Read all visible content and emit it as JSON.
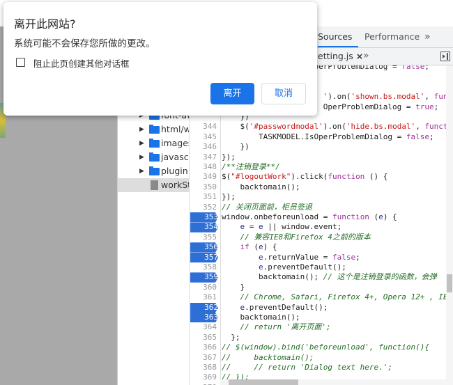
{
  "devtools": {
    "tabs": [
      {
        "label": "Sources",
        "active": true
      },
      {
        "label": "Performance",
        "active": false
      }
    ],
    "more_tabs": "»",
    "open_file": {
      "name": "etting.js",
      "close": "×"
    },
    "more_files": "»",
    "file_tree": [
      {
        "label": "font-aw",
        "type": "folder"
      },
      {
        "label": "html/w",
        "type": "folder"
      },
      {
        "label": "images",
        "type": "folder"
      },
      {
        "label": "javascri",
        "type": "folder"
      },
      {
        "label": "plugin",
        "type": "folder"
      },
      {
        "label": "workSta",
        "type": "file",
        "selected": true
      }
    ],
    "code_lines": [
      {
        "n": "",
        "bp": false,
        "tokens": [
          [
            "p",
            "                    perProblemDialog "
          ],
          [
            "p",
            "= "
          ],
          [
            "k",
            "false"
          ],
          [
            "p",
            ";"
          ]
        ]
      },
      {
        "n": "",
        "bp": false,
        "tokens": []
      },
      {
        "n": "",
        "bp": false,
        "tokens": []
      },
      {
        "n": "",
        "bp": false,
        "tokens": [
          [
            "s",
            "                      '"
          ],
          [
            "p",
            ").on("
          ],
          [
            "s",
            "'shown.bs.modal'"
          ],
          [
            "p",
            ", "
          ],
          [
            "k",
            "func"
          ]
        ]
      },
      {
        "n": "",
        "bp": false,
        "tokens": [
          [
            "p",
            "                      OperProblemDialog = "
          ],
          [
            "k",
            "true"
          ],
          [
            "p",
            ";"
          ]
        ]
      },
      {
        "n": "",
        "bp": false,
        "tokens": [
          [
            "p",
            "    })"
          ]
        ]
      },
      {
        "n": "344",
        "bp": false,
        "tokens": [
          [
            "p",
            "    $("
          ],
          [
            "s",
            "'#passwordmodal'"
          ],
          [
            "p",
            ").on("
          ],
          [
            "s",
            "'hide.bs.modal'"
          ],
          [
            "p",
            ", "
          ],
          [
            "k",
            "funct"
          ]
        ]
      },
      {
        "n": "345",
        "bp": false,
        "tokens": [
          [
            "p",
            "        TASKMODEL.IsOperProblemDialog = "
          ],
          [
            "k",
            "false"
          ],
          [
            "p",
            ";"
          ]
        ]
      },
      {
        "n": "346",
        "bp": false,
        "tokens": [
          [
            "p",
            "    })"
          ]
        ]
      },
      {
        "n": "347",
        "bp": false,
        "tokens": [
          [
            "p",
            "});"
          ]
        ]
      },
      {
        "n": "348",
        "bp": false,
        "tokens": [
          [
            "c",
            "/**注销登录**/"
          ]
        ]
      },
      {
        "n": "349",
        "bp": false,
        "tokens": [
          [
            "p",
            "$("
          ],
          [
            "s",
            "\"#logoutWork\""
          ],
          [
            "p",
            ").click("
          ],
          [
            "k",
            "function"
          ],
          [
            "p",
            " () {"
          ]
        ]
      },
      {
        "n": "350",
        "bp": false,
        "tokens": [
          [
            "p",
            "    backtomain();"
          ]
        ]
      },
      {
        "n": "351",
        "bp": false,
        "tokens": [
          [
            "p",
            "});"
          ]
        ]
      },
      {
        "n": "352",
        "bp": false,
        "tokens": [
          [
            "c",
            "// 关闭页面前，柜员签退"
          ]
        ]
      },
      {
        "n": "353",
        "bp": true,
        "tokens": [
          [
            "p",
            "window.onbeforeunload = "
          ],
          [
            "k",
            "function"
          ],
          [
            "p",
            " ("
          ],
          [
            "v",
            "e"
          ],
          [
            "p",
            ") {"
          ]
        ]
      },
      {
        "n": "354",
        "bp": true,
        "tokens": [
          [
            "p",
            "    "
          ],
          [
            "v",
            "e"
          ],
          [
            "p",
            " = "
          ],
          [
            "v",
            "e"
          ],
          [
            "p",
            " || window.event;"
          ]
        ]
      },
      {
        "n": "355",
        "bp": false,
        "tokens": [
          [
            "c",
            "    // 兼容IE8和Firefox 4之前的版本"
          ]
        ]
      },
      {
        "n": "356",
        "bp": true,
        "tokens": [
          [
            "p",
            "    "
          ],
          [
            "k",
            "if"
          ],
          [
            "p",
            " ("
          ],
          [
            "v",
            "e"
          ],
          [
            "p",
            ") {"
          ]
        ]
      },
      {
        "n": "357",
        "bp": true,
        "tokens": [
          [
            "p",
            "        "
          ],
          [
            "v",
            "e"
          ],
          [
            "p",
            ".returnValue = "
          ],
          [
            "k",
            "false"
          ],
          [
            "p",
            ";"
          ]
        ]
      },
      {
        "n": "358",
        "bp": false,
        "tokens": [
          [
            "p",
            "        "
          ],
          [
            "v",
            "e"
          ],
          [
            "p",
            ".preventDefault();"
          ]
        ]
      },
      {
        "n": "359",
        "bp": true,
        "tokens": [
          [
            "p",
            "        backtomain(); "
          ],
          [
            "c",
            "// 这个是注销登录的函数，会弹"
          ]
        ]
      },
      {
        "n": "360",
        "bp": false,
        "tokens": [
          [
            "p",
            "    }"
          ]
        ]
      },
      {
        "n": "361",
        "bp": false,
        "tokens": [
          [
            "c",
            "    // Chrome, Safari, Firefox 4+, Opera 12+ , IE"
          ]
        ]
      },
      {
        "n": "362",
        "bp": true,
        "tokens": [
          [
            "p",
            "    "
          ],
          [
            "v",
            "e"
          ],
          [
            "p",
            ".preventDefault();"
          ]
        ]
      },
      {
        "n": "363",
        "bp": true,
        "tokens": [
          [
            "p",
            "    backtomain();"
          ]
        ]
      },
      {
        "n": "364",
        "bp": false,
        "tokens": [
          [
            "c",
            "    // return '离开页面';"
          ]
        ]
      },
      {
        "n": "365",
        "bp": false,
        "tokens": [
          [
            "p",
            "  };"
          ]
        ]
      },
      {
        "n": "366",
        "bp": false,
        "tokens": [
          [
            "c",
            "// $(window).bind('beforeunload', function(){"
          ]
        ]
      },
      {
        "n": "367",
        "bp": false,
        "tokens": [
          [
            "c",
            "//     backtomain();"
          ]
        ]
      },
      {
        "n": "368",
        "bp": false,
        "tokens": [
          [
            "c",
            "//     // return 'Dialog text here.';"
          ]
        ]
      },
      {
        "n": "369",
        "bp": false,
        "tokens": [
          [
            "c",
            "// });"
          ]
        ]
      },
      {
        "n": "370",
        "bp": false,
        "tokens": []
      }
    ]
  },
  "dialog": {
    "title": "离开此网站?",
    "message": "系统可能不会保存您所做的更改。",
    "checkbox_label": "阻止此页创建其他对话框",
    "checkbox_checked": false,
    "leave_button": "离开",
    "cancel_button": "取消",
    "accent": "#1a73e8"
  }
}
